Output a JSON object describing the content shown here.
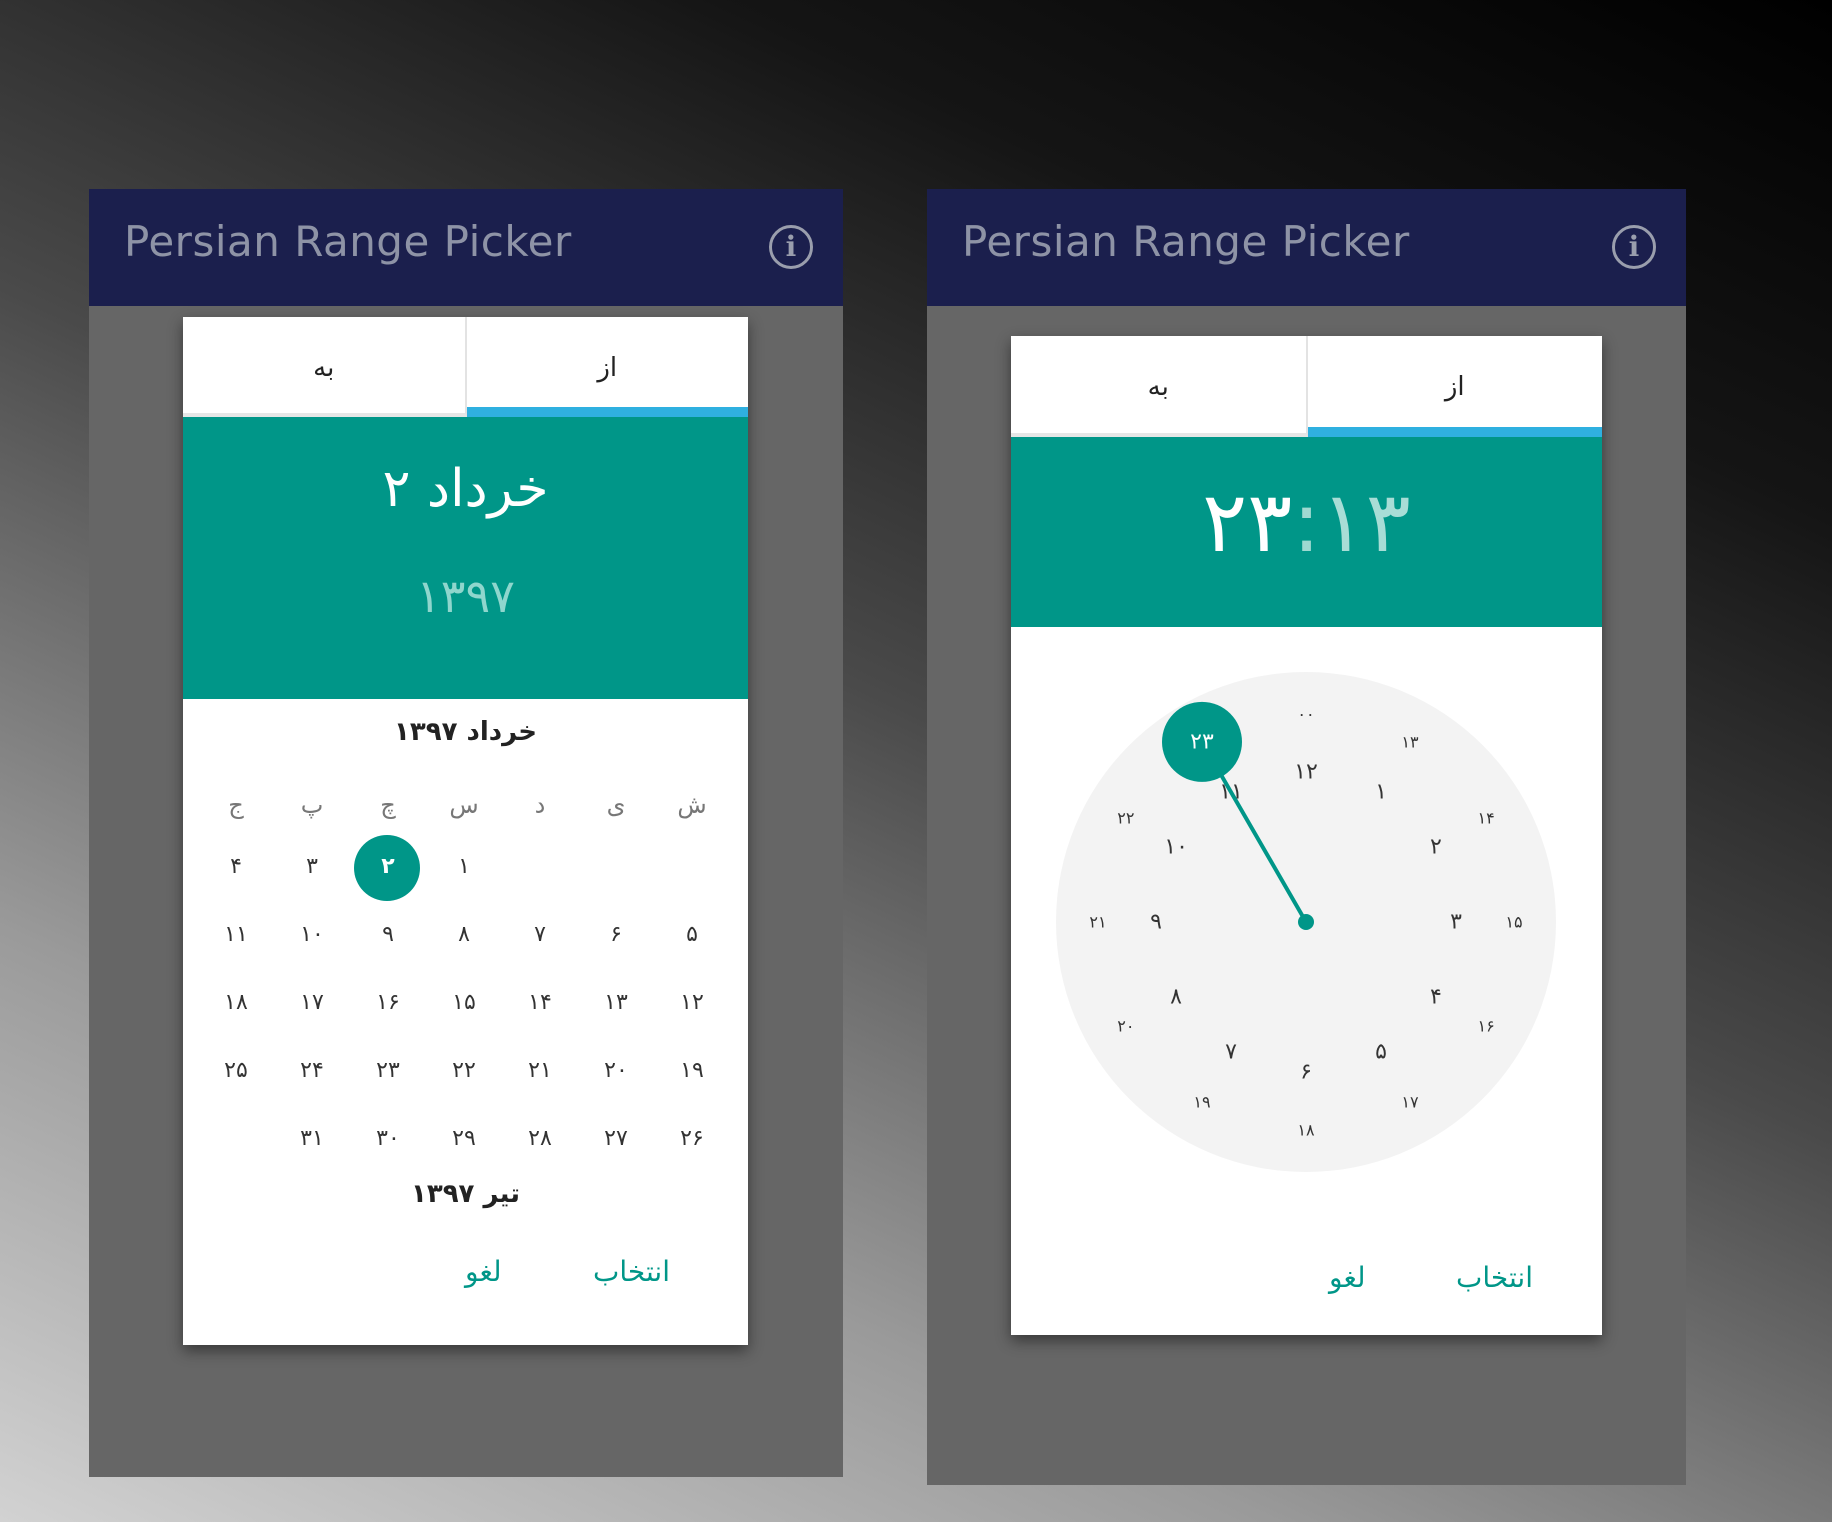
{
  "app": {
    "title": "Persian Range Picker"
  },
  "colors": {
    "appbar": "#1b1f4d",
    "accent": "#009688",
    "tab_indicator": "#2fb0e0"
  },
  "left": {
    "tabs": {
      "to": "به",
      "from": "از"
    },
    "header": {
      "date": "۲ خرداد",
      "year": "۱۳۹۷"
    },
    "month_title": "خرداد ۱۳۹۷",
    "weekdays": [
      "ش",
      "ی",
      "د",
      "س",
      "چ",
      "پ",
      "ج"
    ],
    "weeks": [
      [
        "",
        "",
        "",
        "۱",
        "۲",
        "۳",
        "۴"
      ],
      [
        "۵",
        "۶",
        "۷",
        "۸",
        "۹",
        "۱۰",
        "۱۱"
      ],
      [
        "۱۲",
        "۱۳",
        "۱۴",
        "۱۵",
        "۱۶",
        "۱۷",
        "۱۸"
      ],
      [
        "۱۹",
        "۲۰",
        "۲۱",
        "۲۲",
        "۲۳",
        "۲۴",
        "۲۵"
      ],
      [
        "۲۶",
        "۲۷",
        "۲۸",
        "۲۹",
        "۳۰",
        "۳۱",
        ""
      ]
    ],
    "selected_day": "۲",
    "next_month_title": "تیر ۱۳۹۷",
    "actions": {
      "select": "انتخاب",
      "cancel": "لغو"
    }
  },
  "right": {
    "tabs": {
      "to": "به",
      "from": "از"
    },
    "header": {
      "hour": "۲۳",
      "separator": ":",
      "minute": "۱۳"
    },
    "clock": {
      "inner": [
        "۱۲",
        "۱",
        "۲",
        "۳",
        "۴",
        "۵",
        "۶",
        "۷",
        "۸",
        "۹",
        "۱۰",
        "۱۱"
      ],
      "outer": [
        "۰۰",
        "۱۳",
        "۱۴",
        "۱۵",
        "۱۶",
        "۱۷",
        "۱۸",
        "۱۹",
        "۲۰",
        "۲۱",
        "۲۲",
        "۲۳"
      ],
      "selected": "۲۳"
    },
    "actions": {
      "select": "انتخاب",
      "cancel": "لغو"
    }
  }
}
